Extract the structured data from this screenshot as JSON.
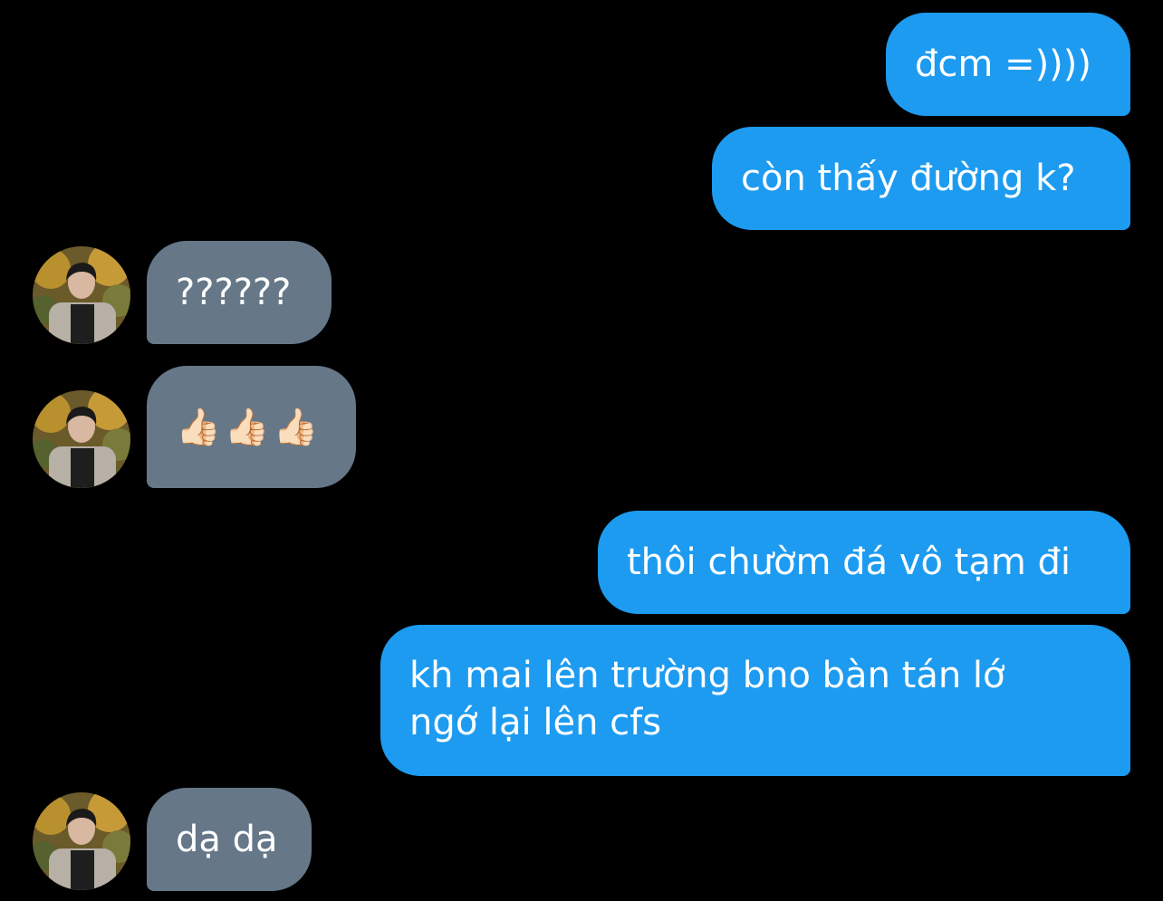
{
  "conversation": {
    "messages": [
      {
        "from": "me",
        "text": "đcm =))))"
      },
      {
        "from": "me",
        "text": "còn thấy đường k?"
      },
      {
        "from": "them",
        "text": "??????"
      },
      {
        "from": "them",
        "text": "👍🏻👍🏻👍🏻"
      },
      {
        "from": "me",
        "text": "thôi chườm đá vô tạm đi"
      },
      {
        "from": "me",
        "lines": [
          "kh mai lên trường bno bàn tán lớ",
          "ngớ lại lên cfs"
        ]
      },
      {
        "from": "them",
        "text": "dạ dạ"
      }
    ]
  },
  "colors": {
    "background": "#000000",
    "sent_bubble": "#1d9bf0",
    "received_bubble": "#667788",
    "text": "#ffffff"
  },
  "icons": {
    "avatar": "contact-avatar-photo"
  }
}
